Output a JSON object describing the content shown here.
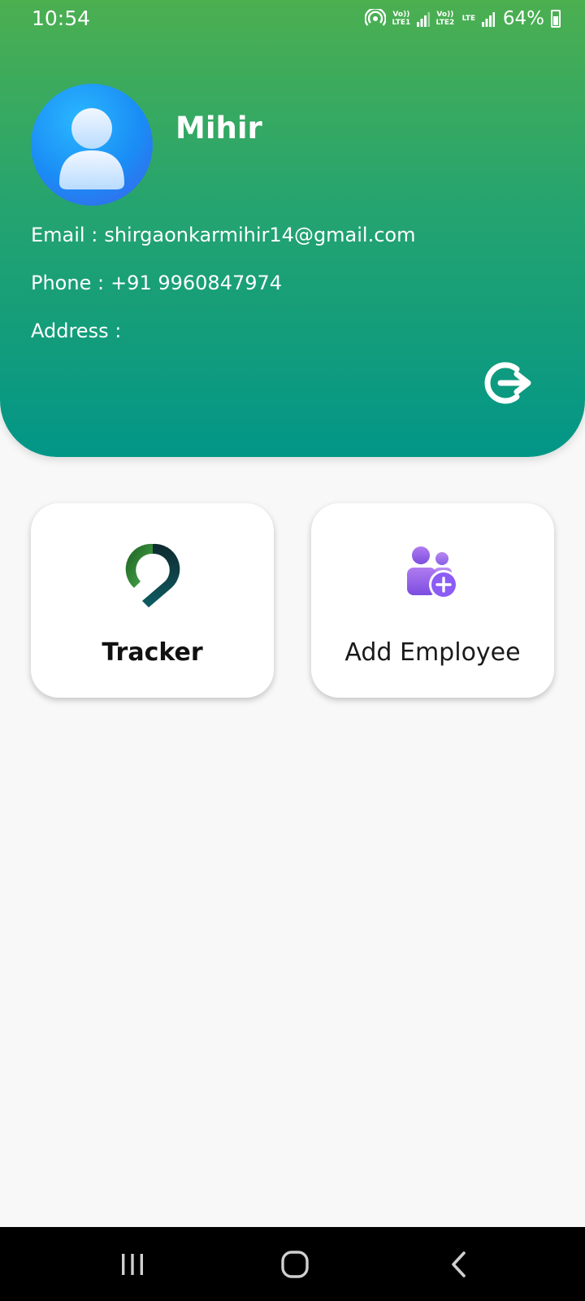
{
  "status_bar": {
    "time": "10:54",
    "hotspot_icon": "hotspot-icon",
    "sim1": "Vo)) LTE1",
    "sim2": "Vo)) LTE2",
    "data_type": "LTE",
    "battery": "64%"
  },
  "profile": {
    "name": "Mihir",
    "email_label": "Email :",
    "email": "shirgaonkarmihir14@gmail.com",
    "phone_label": "Phone :",
    "phone": "+91 9960847974",
    "address_label": "Address :",
    "address": "",
    "avatar_icon": "user-avatar-icon",
    "logout_icon": "logout-icon"
  },
  "cards": [
    {
      "label": "Tracker",
      "icon": "location-pin-icon"
    },
    {
      "label": "Add Employee",
      "icon": "add-user-icon"
    }
  ],
  "nav_bar": {
    "recents_icon": "recents-icon",
    "home_icon": "home-icon",
    "back_icon": "back-icon"
  },
  "colors": {
    "header_top": "#4caf50",
    "header_bottom": "#029687",
    "background": "#f8f8f8",
    "add_employee_accent": "#8b5cf6"
  }
}
